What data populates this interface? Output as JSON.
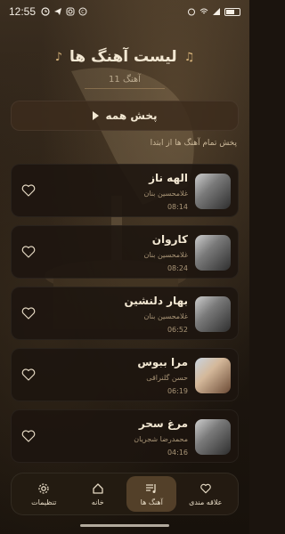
{
  "status": {
    "time": "12:55"
  },
  "header": {
    "title": "لیست آهنگ ها",
    "count": "11 آهنگ"
  },
  "play_all": {
    "label": "پخش همه"
  },
  "hint": "پخش تمام آهنگ ها از ابتدا",
  "songs": [
    {
      "title": "الهه ناز",
      "artist": "غلامحسین بنان",
      "duration": "08:14"
    },
    {
      "title": "کاروان",
      "artist": "غلامحسین بنان",
      "duration": "08:24"
    },
    {
      "title": "بهار دلنشین",
      "artist": "غلامحسین بنان",
      "duration": "06:52"
    },
    {
      "title": "مرا ببوس",
      "artist": "حسن گلنراقی",
      "duration": "06:19"
    },
    {
      "title": "مرغ سحر",
      "artist": "محمدرضا شجریان",
      "duration": "04:16"
    }
  ],
  "nav": {
    "favorites": "علاقه مندی",
    "songs": "آهنگ ها",
    "home": "خانه",
    "settings": "تنظیمات"
  },
  "colors": {
    "accent": "#d6b27a",
    "card": "#1c150f",
    "active_tab": "#5c462e"
  }
}
